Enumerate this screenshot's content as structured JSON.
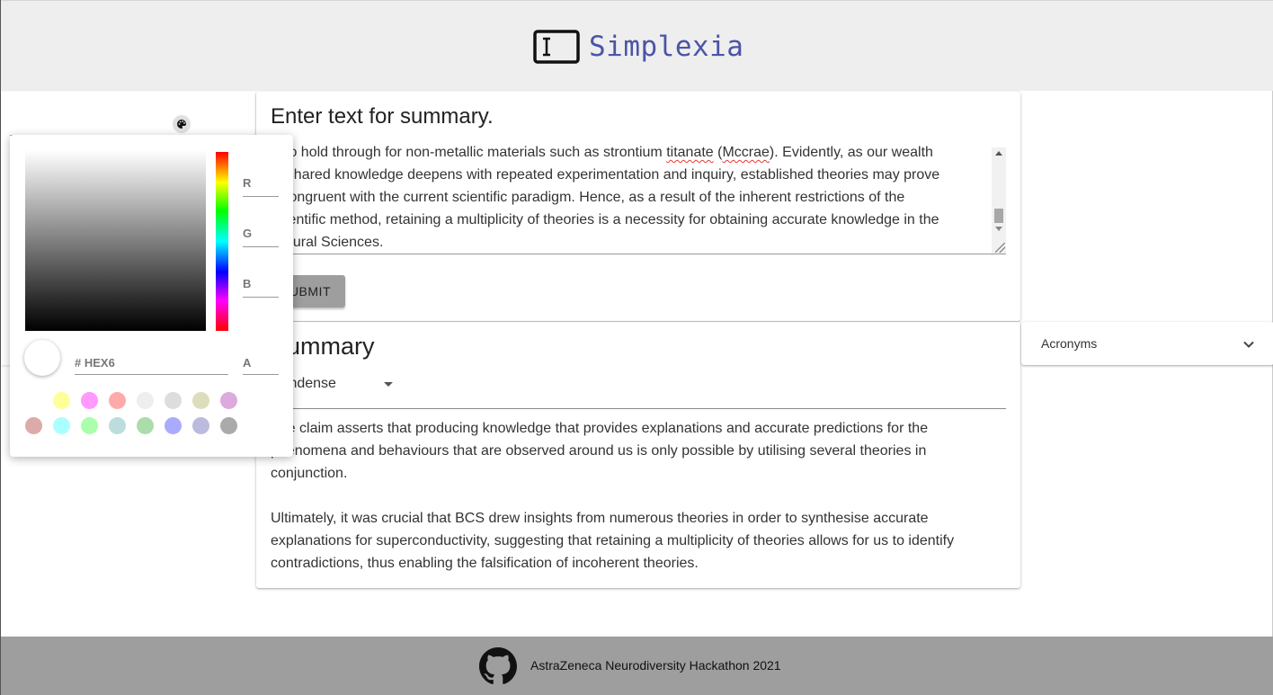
{
  "header": {
    "app_name": "Simplexia",
    "logo_icon": "text-cursor-box-icon"
  },
  "input_panel": {
    "title": "Enter text for summary.",
    "text_lines": [
      {
        "before": "is to hold through for non-metallic materials such as strontium ",
        "word1": "titanate",
        "mid": " (",
        "word2": "Mccrae",
        "after": "). Evidently, as our wealth"
      },
      "of shared knowledge deepens with repeated experimentation and inquiry, established theories may prove",
      "incongruent with the current scientific paradigm. Hence, as a result of the inherent restrictions of the",
      "scientific method, retaining a multiplicity of theories is a necessity for obtaining accurate knowledge in the",
      "Natural Sciences."
    ],
    "submit_label": "SUBMIT"
  },
  "summary_panel": {
    "title": "Summary",
    "mode_select_value": "Condense",
    "paragraphs": [
      "The claim asserts that producing knowledge that provides explanations and accurate predictions for the phenomena and behaviours that are observed around us is only possible by utilising several theories in conjunction.",
      "Ultimately, it was crucial that BCS drew insights from numerous theories in order to synthesise accurate explanations for superconductivity, suggesting that retaining a multiplicity of theories allows for us to identify contradictions, thus enabling the falsification of incoherent theories."
    ]
  },
  "acronyms_panel": {
    "label": "Acronyms",
    "toggle_icon": "chevron-down-icon"
  },
  "color_picker": {
    "labels": {
      "r": "R",
      "g": "G",
      "b": "B",
      "a": "A",
      "hex_placeholder": "# HEX6"
    },
    "hue_color": "#ff0000",
    "selected_color": "#ffffff",
    "swatches_row1": [
      "#ffff99",
      "#ff99ff",
      "#ffaaaa",
      "#eeeeee",
      "#dddddd",
      "#ddddbb",
      "#ddaadd"
    ],
    "swatches_row2": [
      "#ddaaaa",
      "#aaffff",
      "#aaffaa",
      "#bbdddd",
      "#aaddaa",
      "#aaaaff",
      "#bbbbdd",
      "#aaaaaa"
    ]
  },
  "footer": {
    "text": "AstraZeneca Neurodiversity Hackathon 2021",
    "icon": "github-icon"
  }
}
